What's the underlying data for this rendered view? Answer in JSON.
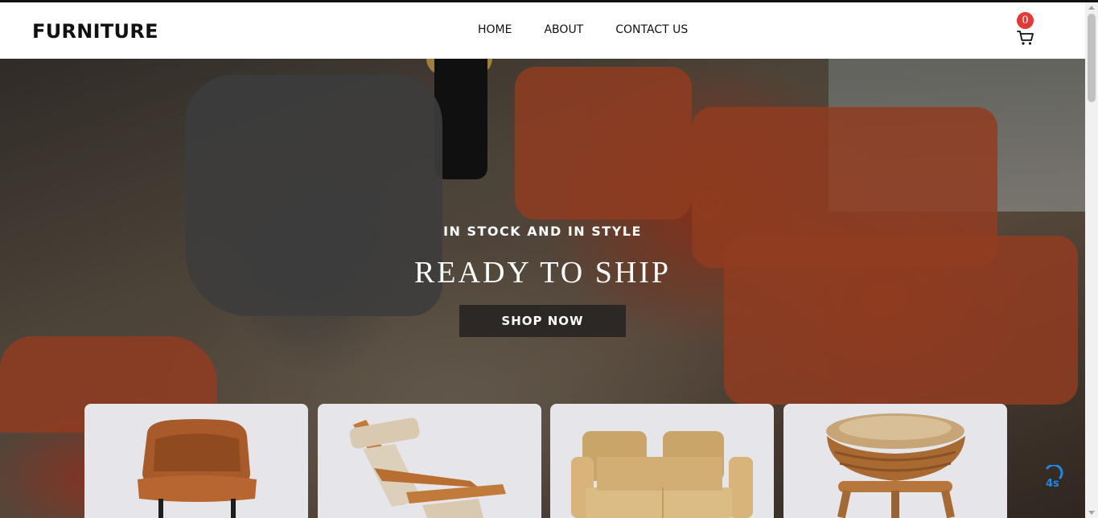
{
  "brand": "FURNITURE",
  "nav": {
    "items": [
      "HOME",
      "ABOUT",
      "CONTACT US"
    ]
  },
  "cart": {
    "count": "0",
    "icon": "cart-icon"
  },
  "hero": {
    "subtitle": "IN STOCK AND IN STYLE",
    "title": "READY TO SHIP",
    "button_label": "SHOP NOW"
  },
  "products": [
    {
      "name": "leather-chair",
      "icon": "armchair"
    },
    {
      "name": "deck-chair",
      "icon": "recliner"
    },
    {
      "name": "loveseat",
      "icon": "sofa"
    },
    {
      "name": "rattan-stool",
      "icon": "stool"
    }
  ],
  "spinner": {
    "text": "4s"
  },
  "colors": {
    "badge": "#e53935",
    "button": "#2b2826",
    "card_bg": "#e6e6ea",
    "spinner": "#1e88e5"
  }
}
